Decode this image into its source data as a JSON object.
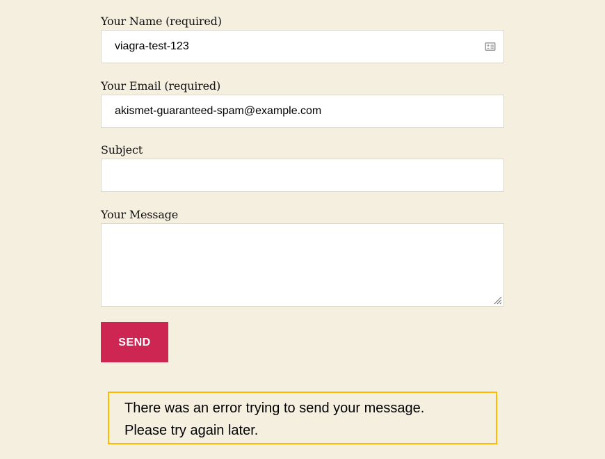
{
  "form": {
    "name_label": "Your Name (required)",
    "name_value": "viagra-test-123",
    "email_label": "Your Email (required)",
    "email_value": "akismet-guaranteed-spam@example.com",
    "subject_label": "Subject",
    "subject_value": "",
    "message_label": "Your Message",
    "message_value": "",
    "send_label": "SEND"
  },
  "error": {
    "line1": "There was an error trying to send your message.",
    "line2": "Please try again later."
  },
  "colors": {
    "background": "#f5efe0",
    "send_button": "#cd2653",
    "error_border": "#ffb900"
  },
  "icons": {
    "name_field": "contact-card-icon",
    "message_field": "resize-handle-icon"
  }
}
